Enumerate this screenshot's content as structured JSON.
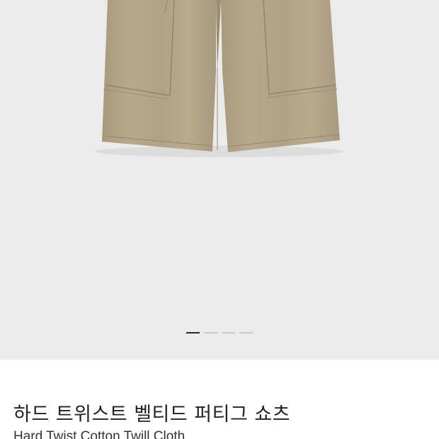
{
  "product_image": {
    "alt_icon": "khaki-shorts-image",
    "background_color": "#ebebeb",
    "garment_color": "#b5a68a"
  },
  "carousel": {
    "total_slides": 4,
    "active_index": 0
  },
  "product": {
    "title_ko": "하드 트위스트 벨티드 퍼티그 쇼츠",
    "title_en": "Hard Twist Cotton Twill Cloth"
  }
}
